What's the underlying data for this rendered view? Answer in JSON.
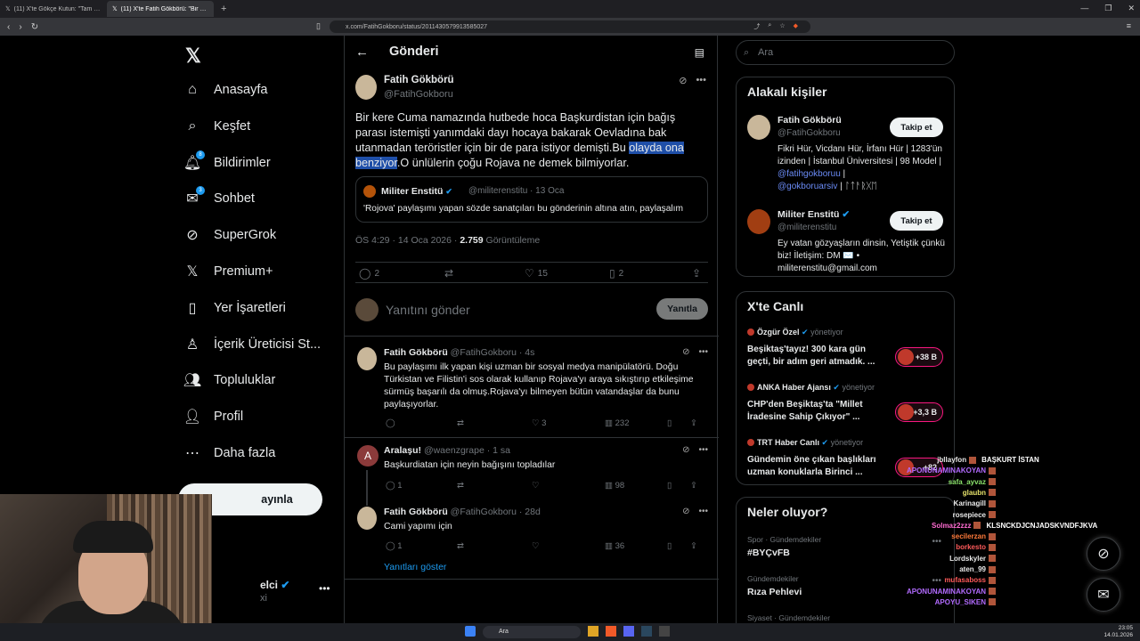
{
  "browser": {
    "tabs": [
      {
        "label": "(11) X'te Gökçe Kutun: \"Tam PKK'ya...",
        "active": false
      },
      {
        "label": "(11) X'te Fatih Gökbörü: \"Bir kere...",
        "active": true
      }
    ],
    "url": "x.com/FatihGokboru/status/2011430579913585027"
  },
  "nav": {
    "items": [
      {
        "label": "Anasayfa",
        "icon": "home-icon"
      },
      {
        "label": "Keşfet",
        "icon": "search-icon"
      },
      {
        "label": "Bildirimler",
        "icon": "bell-icon",
        "badge": "8"
      },
      {
        "label": "Sohbet",
        "icon": "mail-icon",
        "badge": "3"
      },
      {
        "label": "SuperGrok",
        "icon": "grok-icon"
      },
      {
        "label": "Premium+",
        "icon": "x-icon"
      },
      {
        "label": "Yer İşaretleri",
        "icon": "bookmark-icon"
      },
      {
        "label": "İçerik Üreticisi St...",
        "icon": "creator-icon"
      },
      {
        "label": "Topluluklar",
        "icon": "community-icon"
      },
      {
        "label": "Profil",
        "icon": "profile-icon"
      },
      {
        "label": "Daha fazla",
        "icon": "more-icon"
      }
    ],
    "post_button": "ayınla",
    "account_name": "elci",
    "account_sub": "xi"
  },
  "header": {
    "title": "Gönderi"
  },
  "post": {
    "name": "Fatih Gökbörü",
    "handle": "@FatihGokboru",
    "text_before": "Bir kere Cuma namazında hutbede hoca Başkurdistan için bağış parası istemişti yanımdaki dayı hocaya bakarak Oevladına bak utanmadan teröristler için bir de para istiyor demişti.Bu ",
    "text_highlight": "olayda ona benziyor",
    "text_after": ".O ünlülerin çoğu Rojava ne demek bilmiyorlar.",
    "quote": {
      "name": "Militer Enstitü",
      "handle": "@militerenstitu · 13 Oca",
      "text": "'Rojova' paylaşımı yapan sözde sanatçıları bu gönderinin altına atın, paylaşalım"
    },
    "time": "ÖS 4:29 · 14 Oca 2026 · ",
    "views": "2.759",
    "views_label": " Görüntüleme",
    "counts": {
      "replies": "2",
      "reposts": "",
      "likes": "15",
      "bookmarks": "2"
    }
  },
  "reply_box": {
    "placeholder": "Yanıtını gönder",
    "button": "Yanıtla"
  },
  "replies": [
    {
      "name": "Fatih Gökbörü",
      "meta": "@FatihGokboru · 4s",
      "text": "Bu paylaşımı ilk yapan kişi uzman bir sosyal medya manipülatörü. Doğu Türkistan ve Filistin'i sos olarak kullanıp Rojava'yı araya sıkıştırıp etkileşime sürmüş başarılı da olmuş.Rojava'yı bilmeyen bütün vatandaşlar da bunu paylaşıyorlar.",
      "replies": "",
      "reposts": "",
      "likes": "3",
      "views": "232"
    },
    {
      "name": "Aralaşu!",
      "meta": "@waenzgrape · 1 sa",
      "initial": "A",
      "text": "Başkurdiatan için neyin bağışını topladılar",
      "replies": "1",
      "reposts": "",
      "likes": "",
      "views": "98"
    },
    {
      "name": "Fatih Gökbörü",
      "meta": "@FatihGokboru · 28d",
      "text": "Cami yapımı için",
      "replies": "1",
      "reposts": "",
      "likes": "",
      "views": "36"
    }
  ],
  "show_replies": "Yanıtları göster",
  "right": {
    "search_placeholder": "Ara",
    "related_title": "Alakalı kişiler",
    "people": [
      {
        "name": "Fatih Gökbörü",
        "handle": "@FatihGokboru",
        "follow": "Takip et",
        "bio": "Fikri Hür, Vicdanı Hür, İrfanı Hür | 1283'ün izinden | İstanbul Üniversitesi | 98 Model |",
        "bio_link1": "@fatihgokboruu",
        "bio_link2": "@gokboruarsiv",
        "bio_end": " | ᛚᛏᚨᚱᚷᛖ"
      },
      {
        "name": "Militer Enstitü",
        "handle": "@militerenstitu",
        "follow": "Takip et",
        "bio": "Ey vatan gözyaşların dinsin, Yetiştik çünkü biz! İletişim: DM ✉️ • militerenstitu@gmail.com"
      }
    ],
    "live_title": "X'te Canlı",
    "live": [
      {
        "host": "Özgür Özel",
        "status": "yönetiyor",
        "title": "Beşiktaş'tayız! 300 kara gün geçti, bir adım geri atmadık. ...",
        "count": "+38 B"
      },
      {
        "host": "ANKA Haber Ajansı",
        "status": "yönetiyor",
        "title": "CHP'den Beşiktaş'ta \"Millet İradesine Sahip Çıkıyor\" ...",
        "count": "+3,3 B"
      },
      {
        "host": "TRT Haber Canlı",
        "status": "yönetiyor",
        "title": "Gündemin öne çıkan başlıkları uzman konuklarla Birinci ...",
        "count": "+82"
      }
    ],
    "trends_title": "Neler oluyor?",
    "trends": [
      {
        "category": "Spor · Gündemdekiler",
        "name": "#BYÇvFB"
      },
      {
        "category": "Gündemdekiler",
        "name": "Rıza Pehlevi"
      },
      {
        "category": "Siyaset · Gündemdekiler",
        "name": ""
      }
    ]
  },
  "chat": [
    {
      "user": "jbllayfon",
      "msg": "BAŞKURT İSTAN",
      "color": "#e8e8e8"
    },
    {
      "user": "APONUNAMINAKOYAN",
      "msg": "",
      "color": "#b26bff"
    },
    {
      "user": "safa_ayvaz",
      "msg": "",
      "color": "#8be36b"
    },
    {
      "user": "glaubn",
      "msg": "",
      "color": "#e6e26b"
    },
    {
      "user": "Karinagill",
      "msg": "",
      "color": "#e8e8e8"
    },
    {
      "user": "rosepiece",
      "msg": "",
      "color": "#e8e8e8"
    },
    {
      "user": "Solmaz2zzz",
      "msg": "KLSNCKDJCNJADSKVNDFJKVA",
      "color": "#ff6bd1"
    },
    {
      "user": "secilerzan",
      "msg": "",
      "color": "#ff7a3a"
    },
    {
      "user": "borkesto",
      "msg": "",
      "color": "#ff5a5a"
    },
    {
      "user": "Lordskyler",
      "msg": "",
      "color": "#e8e8e8"
    },
    {
      "user": "aten_99",
      "msg": "",
      "color": "#e8e8e8"
    },
    {
      "user": "mufasaboss",
      "msg": "",
      "color": "#ff5a5a"
    },
    {
      "user": "APONUNAMINAKOYAN",
      "msg": "",
      "color": "#b26bff"
    },
    {
      "user": "APOYU_SIKEN",
      "msg": "",
      "color": "#b26bff"
    }
  ],
  "taskbar": {
    "search": "Ara",
    "time": "23:05",
    "date": "14.01.2026"
  }
}
